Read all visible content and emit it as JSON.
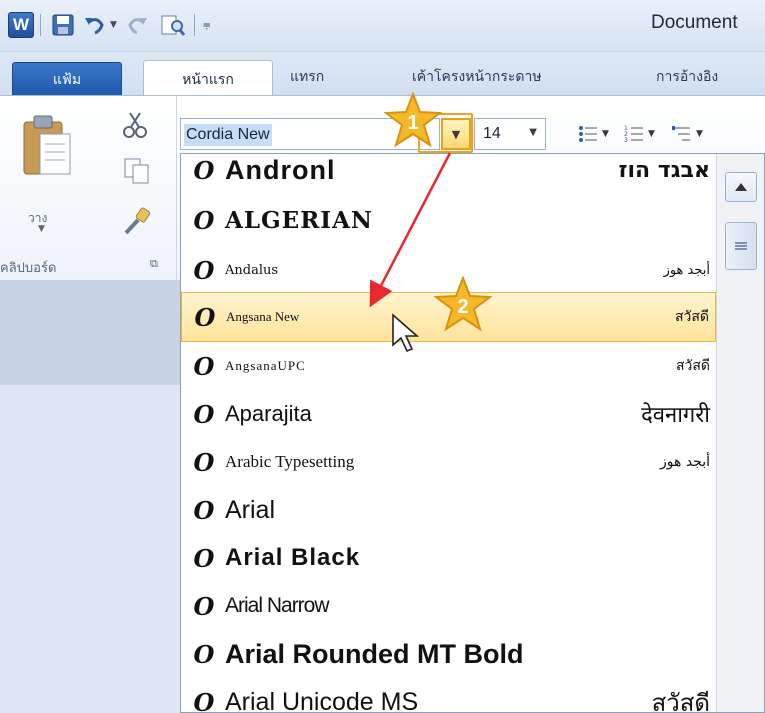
{
  "app": {
    "title_text": "Document",
    "word_icon_letter": "W"
  },
  "quick_access": {
    "icons": [
      "word-icon",
      "save-icon",
      "undo-icon",
      "redo-icon",
      "print-preview-icon",
      "customize-icon"
    ]
  },
  "tabs": [
    {
      "label": "แฟ้ม",
      "kind": "file"
    },
    {
      "label": "หน้าแรก",
      "kind": "active"
    },
    {
      "label": "แทรก"
    },
    {
      "label": "เค้าโครงหน้ากระดาษ"
    },
    {
      "label": "การอ้างอิง"
    }
  ],
  "ribbon": {
    "paste_label": "วาง",
    "clipboard_group": "คลิปบอร์ด",
    "font_combo_value": "Cordia New",
    "font_size_value": "14"
  },
  "badges": [
    "1",
    "2"
  ],
  "font_list": [
    {
      "name": "Andronl",
      "sample": "אבגד הוז",
      "style": "aharoni"
    },
    {
      "name": "ALGERIAN",
      "sample": "",
      "style": "algerian"
    },
    {
      "name": "Andalus",
      "sample": "أبجد هوز",
      "style": "andalus"
    },
    {
      "name": "Angsana New",
      "sample": "สวัสดี",
      "style": "angsana",
      "selected": true
    },
    {
      "name": "AngsanaUPC",
      "sample": "สวัสดี",
      "style": "angsanaupc"
    },
    {
      "name": "Aparajita",
      "sample": "देवनागरी",
      "style": "aparajita"
    },
    {
      "name": "Arabic Typesetting",
      "sample": "أبجد هوز",
      "style": "arabic"
    },
    {
      "name": "Arial",
      "sample": "",
      "style": "arial"
    },
    {
      "name": "Arial Black",
      "sample": "",
      "style": "arialblack"
    },
    {
      "name": "Arial Narrow",
      "sample": "",
      "style": "arialnarrow"
    },
    {
      "name": "Arial Rounded MT Bold",
      "sample": "",
      "style": "arialrounded"
    },
    {
      "name": "Arial Unicode MS",
      "sample": "สวัสดี",
      "style": "arialunicode"
    }
  ],
  "colors": {
    "accent_orange": "#f0a21c",
    "arrow_red": "#e8282e",
    "file_tab_blue": "#1f59ad",
    "selected_item": "#ffe39a"
  }
}
